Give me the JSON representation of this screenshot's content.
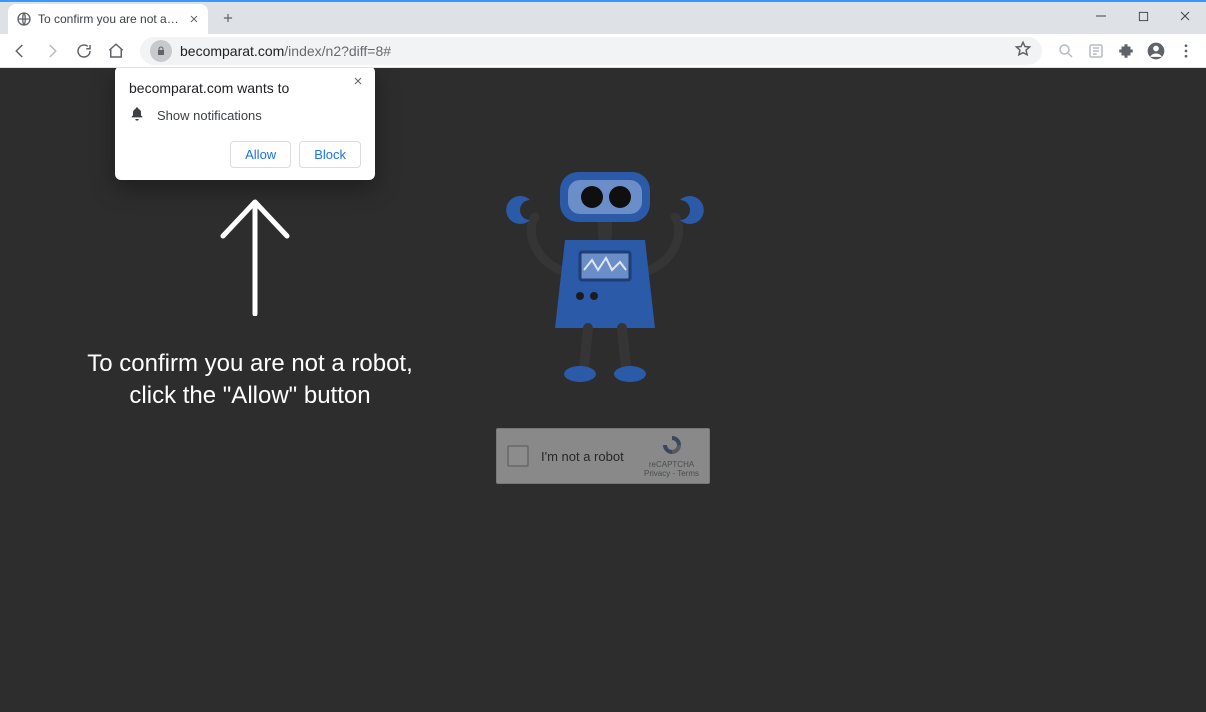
{
  "browser": {
    "tab": {
      "title": "To confirm you are not a robot, c"
    },
    "omnibox": {
      "host": "becomparat.com",
      "path": "/index/n2?diff=8#"
    }
  },
  "permission_dialog": {
    "title": "becomparat.com wants to",
    "item_label": "Show notifications",
    "allow_label": "Allow",
    "block_label": "Block"
  },
  "page": {
    "message_line1": "To confirm you are not a robot,",
    "message_line2": "click the \"Allow\" button"
  },
  "recaptcha": {
    "label": "I'm not a robot",
    "brand": "reCAPTCHA",
    "legal": "Privacy - Terms"
  }
}
